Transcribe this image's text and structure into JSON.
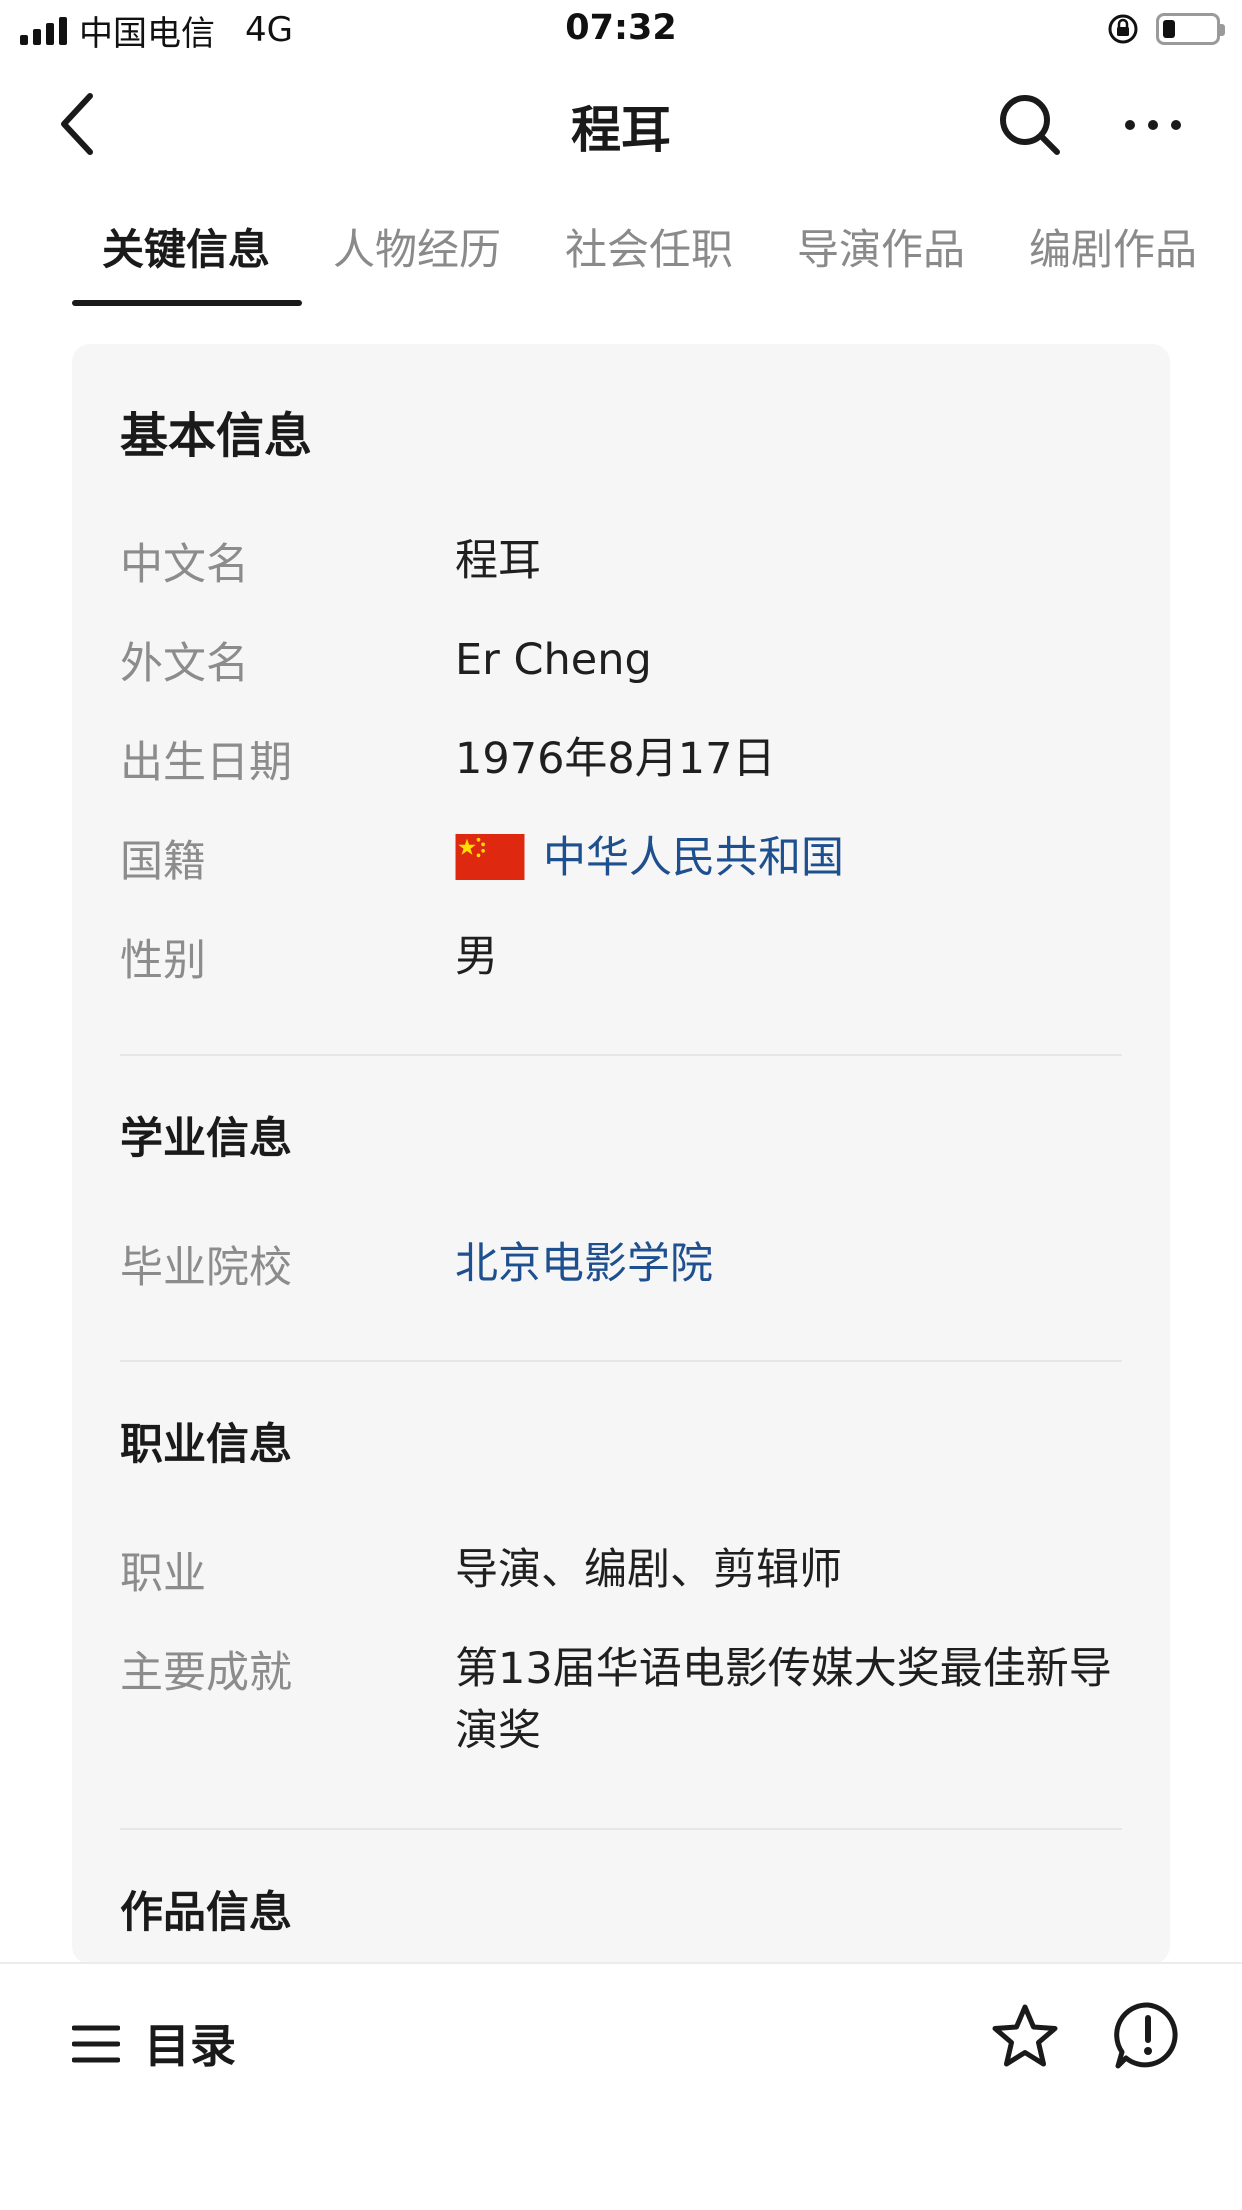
{
  "status_bar": {
    "carrier": "中国电信",
    "network": "4G",
    "time": "07:32",
    "battery_level": 0.2
  },
  "nav": {
    "title": "程耳",
    "back_icon": "chevron-left-icon",
    "search_icon": "search-icon",
    "more_icon": "more-icon"
  },
  "tabs": [
    {
      "label": "关键信息",
      "active": true
    },
    {
      "label": "人物经历",
      "active": false
    },
    {
      "label": "社会任职",
      "active": false
    },
    {
      "label": "导演作品",
      "active": false
    },
    {
      "label": "编剧作品",
      "active": false
    }
  ],
  "basic_info": {
    "title": "基本信息",
    "rows": [
      {
        "label": "中文名",
        "value": "程耳"
      },
      {
        "label": "外文名",
        "value": "Er Cheng"
      },
      {
        "label": "出生日期",
        "value": "1976年8月17日"
      },
      {
        "label": "国籍",
        "value": "中华人民共和国"
      },
      {
        "label": "性别",
        "value": "男"
      }
    ]
  },
  "education": {
    "title": "学业信息",
    "rows": [
      {
        "label": "毕业院校",
        "value": "北京电影学院"
      }
    ]
  },
  "career": {
    "title": "职业信息",
    "rows": [
      {
        "label": "职业",
        "value": "导演、编剧、剪辑师"
      },
      {
        "label": "主要成就",
        "value": "第13届华语电影传媒大奖最佳新导演奖"
      }
    ]
  },
  "works": {
    "title": "作品信息"
  },
  "bottom_bar": {
    "menu_label": "目录",
    "menu_icon": "list-icon",
    "star_icon": "star-icon",
    "report_icon": "report-icon"
  },
  "colors": {
    "link": "#1e4f8e",
    "flag_red": "#de2910",
    "flag_yellow": "#ffde00",
    "card_bg": "#f6f6f7"
  }
}
